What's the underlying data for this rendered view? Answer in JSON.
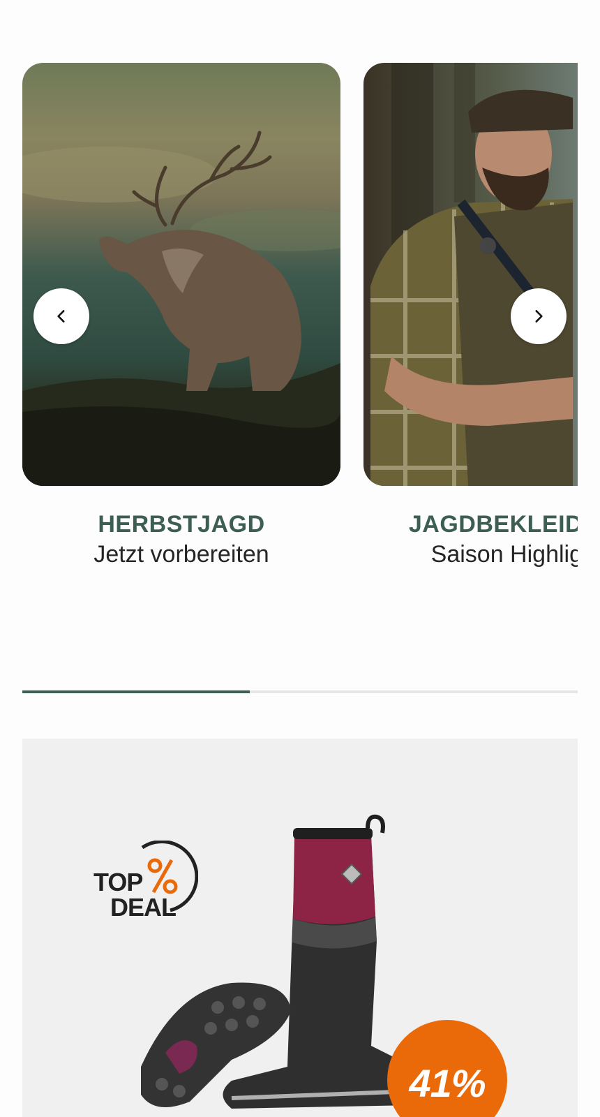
{
  "carousel": {
    "slides": [
      {
        "title": "HERBSTJAGD",
        "subtitle": "Jetzt vorbereiten",
        "image": "red-deer-stag-photo"
      },
      {
        "title": "JAGDBEKLEIDUNG",
        "subtitle": "Saison Highlights",
        "image": "hunter-in-plaid-shirt-photo"
      }
    ],
    "prev_icon": "chevron-left-icon",
    "next_icon": "chevron-right-icon",
    "progress": 0.41
  },
  "deal": {
    "logo_line1": "TOP",
    "logo_line2": "DEAL",
    "discount": "41%",
    "product_image": "rubber-boot-photo",
    "colors": {
      "accent": "#ea6a0a",
      "brand_green": "#3d5e52"
    }
  }
}
